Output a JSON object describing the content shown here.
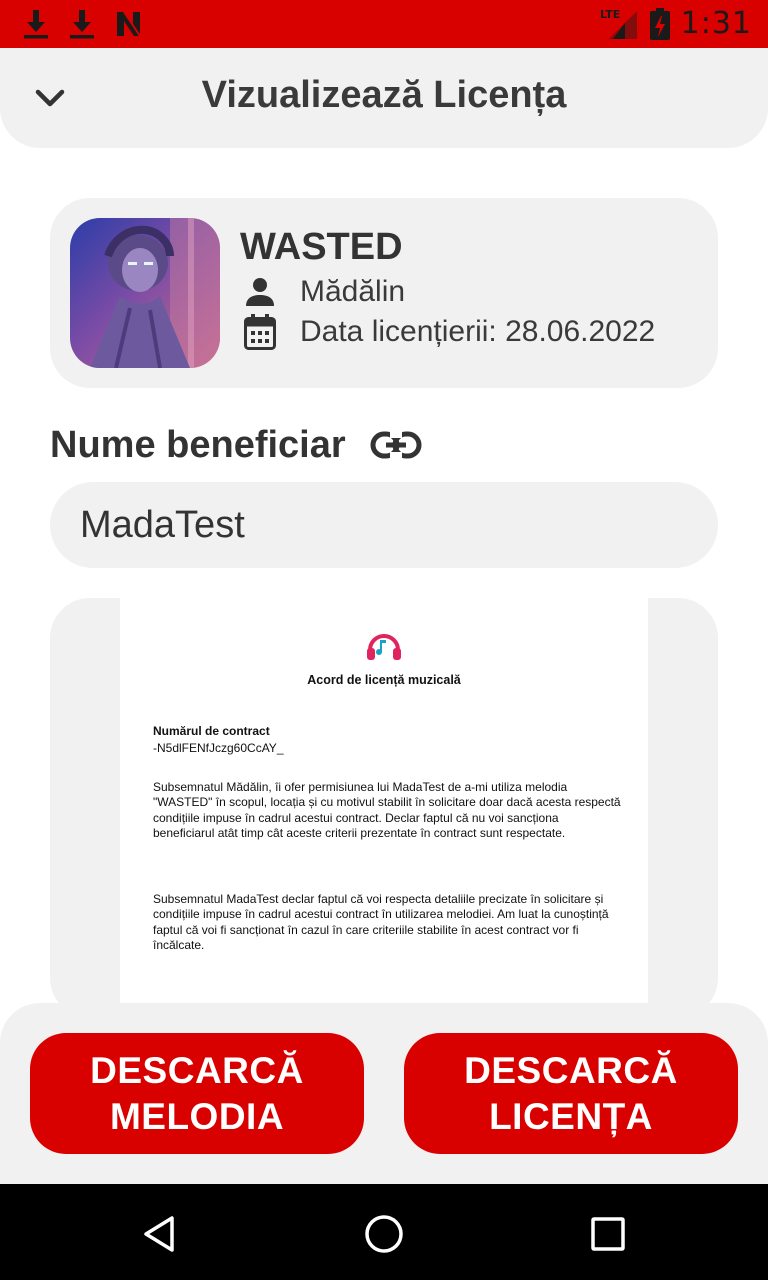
{
  "status_bar": {
    "time": "1:31",
    "network": "LTE",
    "icons": [
      "download-icon",
      "download-icon",
      "notification-n-icon",
      "signal-icon",
      "battery-charging-icon"
    ],
    "color": "#d90000"
  },
  "header": {
    "title": "Vizualizează Licența",
    "back_icon": "chevron-down-icon"
  },
  "track": {
    "title": "WASTED",
    "artist": "Mădălin",
    "license_date": "Data licențierii: 28.06.2022",
    "artist_icon": "person-icon",
    "date_icon": "calendar-icon"
  },
  "beneficiary": {
    "label": "Nume beneficiar",
    "link_icon": "link-icon",
    "value": "MadaTest"
  },
  "document": {
    "title": "Acord de licență muzicală",
    "contract_label": "Numărul de contract",
    "contract_id": "-N5dlFENfJczg60CcAY_",
    "paragraph1": "Subsemnatul Mădălin, îi ofer permisiunea lui MadaTest de a-mi utiliza melodia \"WASTED\" în scopul, locația și cu motivul stabilit în solicitare doar dacă acesta respectă condițiile impuse în cadrul acestui contract. Declar faptul că nu voi sancționa beneficiarul atât timp cât aceste criterii prezentate în contract sunt respectate.",
    "paragraph2": "Subsemnatul MadaTest declar faptul că voi respecta detaliile precizate în solicitare și condițiile impuse în cadrul acestui contract în utilizarea melodiei. Am luat la cunoștință faptul că voi fi sancționat în cazul în care criteriile stabilite în acest contract vor fi încălcate."
  },
  "buttons": {
    "download_melody_line1": "DESCARCĂ",
    "download_melody_line2": "MELODIA",
    "download_license_line1": "DESCARCĂ",
    "download_license_line2": "LICENȚA"
  },
  "colors": {
    "accent": "#d90000",
    "panel": "#f1f1f1",
    "text": "#333333"
  },
  "nav": {
    "icons": [
      "back-icon",
      "home-icon",
      "recents-icon"
    ]
  }
}
